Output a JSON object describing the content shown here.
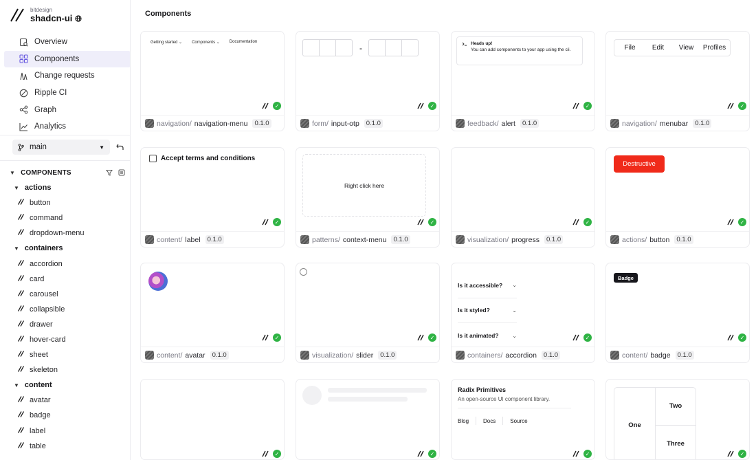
{
  "brand": {
    "org": "bitdesign",
    "name": "shadcn-ui"
  },
  "nav": [
    {
      "label": "Overview",
      "icon": "overview-icon",
      "active": false
    },
    {
      "label": "Components",
      "icon": "components-icon",
      "active": true
    },
    {
      "label": "Change requests",
      "icon": "change-requests-icon",
      "active": false
    },
    {
      "label": "Ripple CI",
      "icon": "ripple-ci-icon",
      "active": false
    },
    {
      "label": "Graph",
      "icon": "graph-icon",
      "active": false
    },
    {
      "label": "Analytics",
      "icon": "analytics-icon",
      "active": false
    }
  ],
  "branch": {
    "name": "main"
  },
  "tree": {
    "heading": "COMPONENTS",
    "groups": [
      {
        "label": "actions",
        "items": [
          "button",
          "command",
          "dropdown-menu"
        ]
      },
      {
        "label": "containers",
        "items": [
          "accordion",
          "card",
          "carousel",
          "collapsible",
          "drawer",
          "hover-card",
          "sheet",
          "skeleton"
        ]
      },
      {
        "label": "content",
        "items": [
          "avatar",
          "badge",
          "label",
          "table"
        ]
      }
    ]
  },
  "header": {
    "title": "Components"
  },
  "cards": [
    {
      "scope": "navigation/",
      "name": "navigation-menu",
      "version": "0.1.0"
    },
    {
      "scope": "form/",
      "name": "input-otp",
      "version": "0.1.0"
    },
    {
      "scope": "feedback/",
      "name": "alert",
      "version": "0.1.0"
    },
    {
      "scope": "navigation/",
      "name": "menubar",
      "version": "0.1.0"
    },
    {
      "scope": "content/",
      "name": "label",
      "version": "0.1.0"
    },
    {
      "scope": "patterns/",
      "name": "context-menu",
      "version": "0.1.0"
    },
    {
      "scope": "visualization/",
      "name": "progress",
      "version": "0.1.0"
    },
    {
      "scope": "actions/",
      "name": "button",
      "version": "0.1.0"
    },
    {
      "scope": "content/",
      "name": "avatar",
      "version": "0.1.0"
    },
    {
      "scope": "visualization/",
      "name": "slider",
      "version": "0.1.0"
    },
    {
      "scope": "containers/",
      "name": "accordion",
      "version": "0.1.0"
    },
    {
      "scope": "content/",
      "name": "badge",
      "version": "0.1.0"
    }
  ],
  "previews": {
    "navmenu": [
      "Getting started",
      "Components",
      "Documentation"
    ],
    "alert": {
      "title": "Heads up!",
      "text": "You can add components to your app using the cli."
    },
    "menubar": [
      "File",
      "Edit",
      "View",
      "Profiles"
    ],
    "label": "Accept terms and conditions",
    "context": "Right click here",
    "button": "Destructive",
    "accordion": [
      "Is it accessible?",
      "Is it styled?",
      "Is it animated?"
    ],
    "badge": "Badge",
    "radix": {
      "title": "Radix Primitives",
      "desc": "An open-source UI component library.",
      "links": [
        "Blog",
        "Docs",
        "Source"
      ]
    },
    "resizable": [
      "One",
      "Two",
      "Three"
    ]
  },
  "colors": {
    "accent_bg": "#efeefa",
    "success": "#2fb344",
    "destructive": "#f02a1a"
  }
}
